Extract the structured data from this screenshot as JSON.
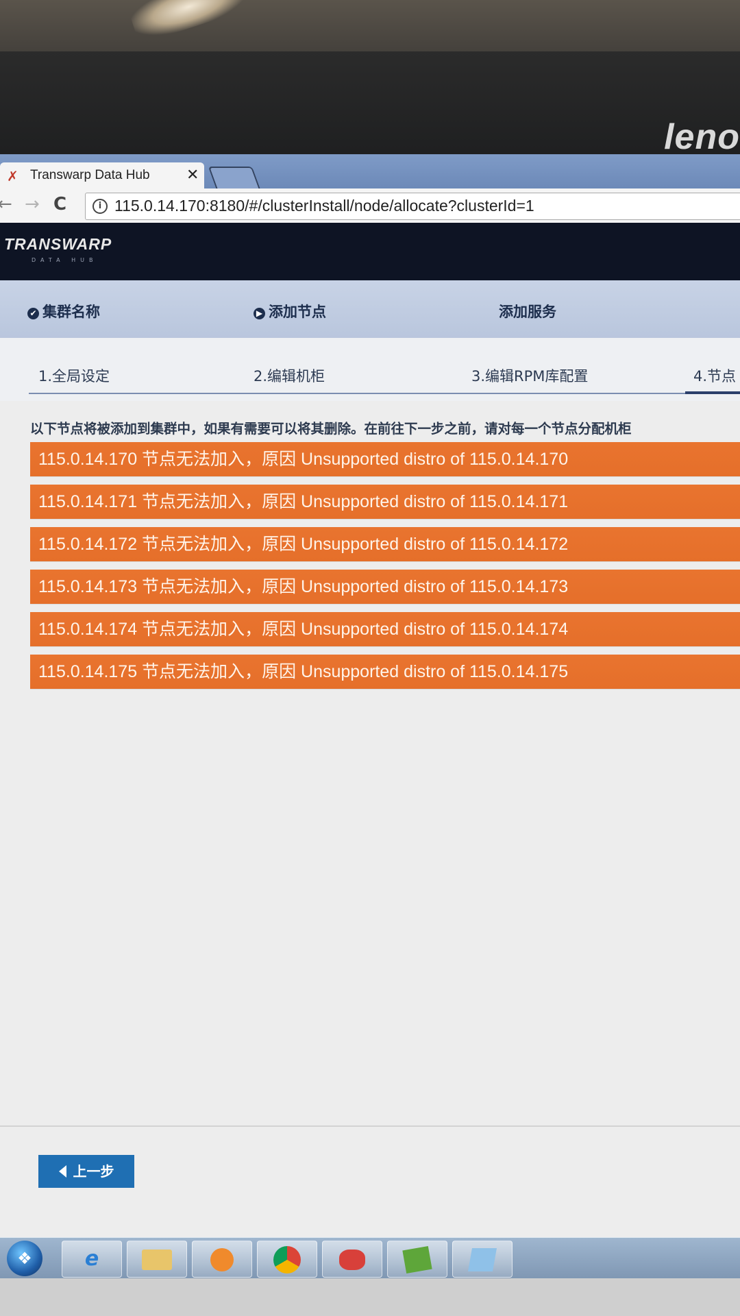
{
  "monitor": {
    "brand": "leno"
  },
  "browser": {
    "tab_title": "Transwarp Data Hub",
    "tab_close": "✕",
    "url": "115.0.14.170:8180/#/clusterInstall/node/allocate?clusterId=1",
    "nav": {
      "back": "←",
      "forward": "→",
      "reload": "C",
      "info": "i"
    }
  },
  "app": {
    "logo": "TRANSWARP",
    "logo_sub": "DATA HUB"
  },
  "wizard": {
    "steps": [
      {
        "label": "集群名称",
        "icon": "✔"
      },
      {
        "label": "添加节点",
        "icon": "▶"
      },
      {
        "label": "添加服务",
        "icon": ""
      }
    ],
    "substeps": [
      {
        "label": "1.全局设定"
      },
      {
        "label": "2.编辑机柜"
      },
      {
        "label": "3.编辑RPM库配置"
      },
      {
        "label": "4.节点"
      }
    ]
  },
  "content": {
    "intro": "以下节点将被添加到集群中，如果有需要可以将其删除。在前往下一步之前，请对每一个节点分配机柜",
    "alerts": [
      "115.0.14.170 节点无法加入，原因 Unsupported distro of 115.0.14.170",
      "115.0.14.171 节点无法加入，原因 Unsupported distro of 115.0.14.171",
      "115.0.14.172 节点无法加入，原因 Unsupported distro of 115.0.14.172",
      "115.0.14.173 节点无法加入，原因 Unsupported distro of 115.0.14.173",
      "115.0.14.174 节点无法加入，原因 Unsupported distro of 115.0.14.174",
      "115.0.14.175 节点无法加入，原因 Unsupported distro of 115.0.14.175"
    ],
    "back_button": "上一步"
  },
  "colors": {
    "alert_bg": "#e9742f",
    "back_button_bg": "#1f6fb3",
    "header_bg": "#0e1424"
  },
  "taskbar": {
    "items": [
      {
        "icon": "start-orb-icon"
      },
      {
        "icon": "internet-explorer-icon"
      },
      {
        "icon": "file-explorer-icon"
      },
      {
        "icon": "media-player-icon"
      },
      {
        "icon": "chrome-icon"
      },
      {
        "icon": "app-red-icon"
      },
      {
        "icon": "app-green-icon"
      },
      {
        "icon": "app-blue-icon"
      }
    ]
  }
}
